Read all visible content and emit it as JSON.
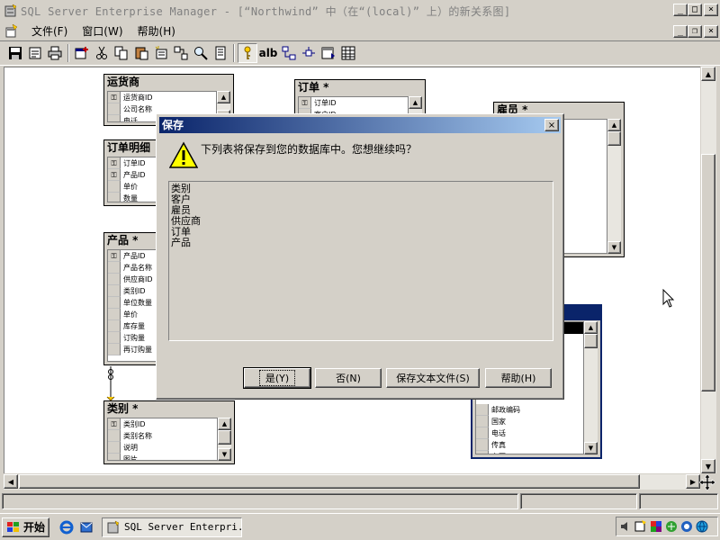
{
  "window": {
    "title": "SQL Server Enterprise Manager - [“Northwind” 中（在“(local)” 上）的新关系图]",
    "app_icon": "sql-server-icon",
    "minimize": "_",
    "maximize": "□",
    "close": "×"
  },
  "menu": {
    "items": [
      {
        "label": "文件(F)"
      },
      {
        "label": "窗口(W)"
      },
      {
        "label": "帮助(H)"
      }
    ],
    "mdi_minimize": "_",
    "mdi_restore": "❐",
    "mdi_close": "×"
  },
  "toolbar": {
    "text_button_label": "alb",
    "icons": [
      "save-icon",
      "properties-icon",
      "print-icon",
      "add-table-icon",
      "cut-icon",
      "copy-icon",
      "paste-icon",
      "new-text-icon",
      "relationship-icon",
      "zoom-icon",
      "show-icon",
      "primary-key-icon",
      "text-icon",
      "arrange-icon",
      "autosize-icon",
      "new-table-icon",
      "grid-icon"
    ]
  },
  "diagram": {
    "tables": [
      {
        "id": "shippers",
        "title": "运货商",
        "rows": [
          {
            "name": "运货商ID",
            "key": true
          },
          {
            "name": "公司名称",
            "key": false
          },
          {
            "name": "电话",
            "key": false
          }
        ]
      },
      {
        "id": "orders",
        "title": "订单 *",
        "rows": [
          {
            "name": "订单ID",
            "key": true
          },
          {
            "name": "客户ID",
            "key": false
          }
        ]
      },
      {
        "id": "employees",
        "title": "雇员 *",
        "rows": []
      },
      {
        "id": "order_details",
        "title": "订单明细",
        "rows": [
          {
            "name": "订单ID",
            "key": true
          },
          {
            "name": "产品ID",
            "key": true
          },
          {
            "name": "单价",
            "key": false
          },
          {
            "name": "数量",
            "key": false
          }
        ]
      },
      {
        "id": "products",
        "title": "产品 *",
        "rows": [
          {
            "name": "产品ID",
            "key": true
          },
          {
            "name": "产品名称",
            "key": false
          },
          {
            "name": "供应商ID",
            "key": false
          },
          {
            "name": "类别ID",
            "key": false
          },
          {
            "name": "单位数量",
            "key": false
          },
          {
            "name": "单价",
            "key": false
          },
          {
            "name": "库存量",
            "key": false
          },
          {
            "name": "订购量",
            "key": false
          },
          {
            "name": "再订购量",
            "key": false
          }
        ]
      },
      {
        "id": "categories",
        "title": "类别 *",
        "rows": [
          {
            "name": "类别ID",
            "key": true
          },
          {
            "name": "类别名称",
            "key": false
          },
          {
            "name": "说明",
            "key": false
          },
          {
            "name": "图片",
            "key": false
          }
        ]
      },
      {
        "id": "customers",
        "title": "",
        "rows": [
          {
            "name": "邮政编码",
            "key": false
          },
          {
            "name": "国家",
            "key": false
          },
          {
            "name": "电话",
            "key": false
          },
          {
            "name": "传真",
            "key": false
          },
          {
            "name": "主页",
            "key": false
          }
        ]
      }
    ]
  },
  "dialog": {
    "title": "保存",
    "close": "×",
    "message": "下列表将保存到您的数据库中。您想继续吗？",
    "icon": "warning-icon",
    "tables": [
      "类别",
      "客户",
      "雇员",
      "供应商",
      "订单",
      "产品"
    ],
    "buttons": {
      "yes": "是(Y)",
      "no": "否(N)",
      "save_text": "保存文本文件(S)",
      "help": "帮助(H)"
    }
  },
  "taskbar": {
    "start_label": "开始",
    "task_label": "SQL Server Enterpri...",
    "quick_launch": [
      "ie-icon",
      "outlook-icon"
    ],
    "tray": [
      "volume-icon",
      "app-tray-icon",
      "color-tray-icon",
      "network-tray-icon",
      "security-tray-icon",
      "globe-tray-icon"
    ]
  },
  "colors": {
    "active_title": "#0a246a",
    "face": "#d4d0c8"
  }
}
